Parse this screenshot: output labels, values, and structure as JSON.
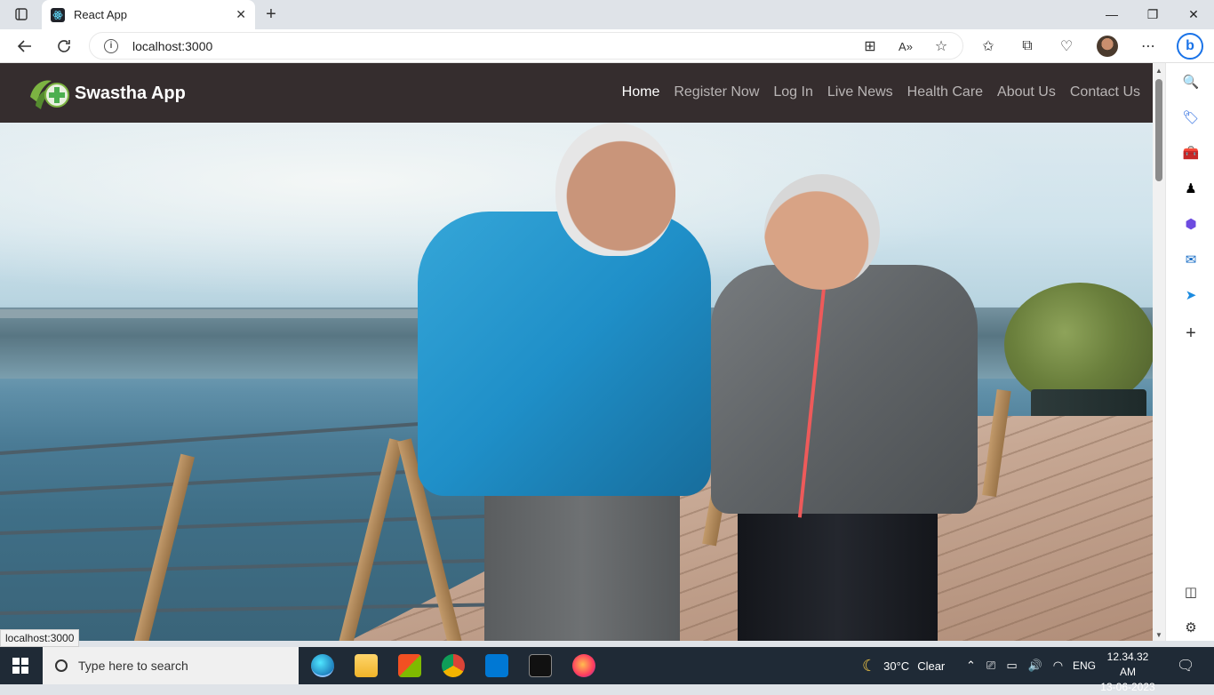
{
  "browser": {
    "tab_title": "React App",
    "url": "localhost:3000",
    "status_url": "localhost:3000"
  },
  "app": {
    "brand": "Swastha App",
    "nav": [
      {
        "label": "Home",
        "active": true
      },
      {
        "label": "Register Now",
        "active": false
      },
      {
        "label": "Log In",
        "active": false
      },
      {
        "label": "Live News",
        "active": false
      },
      {
        "label": "Health Care",
        "active": false
      },
      {
        "label": "About Us",
        "active": false
      },
      {
        "label": "Contact Us",
        "active": false
      }
    ],
    "colors": {
      "navbar": "#352d2e",
      "nav_active": "#ffffff",
      "nav_inactive": "#b9b5b5"
    }
  },
  "taskbar": {
    "search_placeholder": "Type here to search",
    "weather": "30°C",
    "weather_text": "Clear",
    "language": "ENG",
    "time": "12.34.32 AM",
    "date": "13-06-2023"
  }
}
